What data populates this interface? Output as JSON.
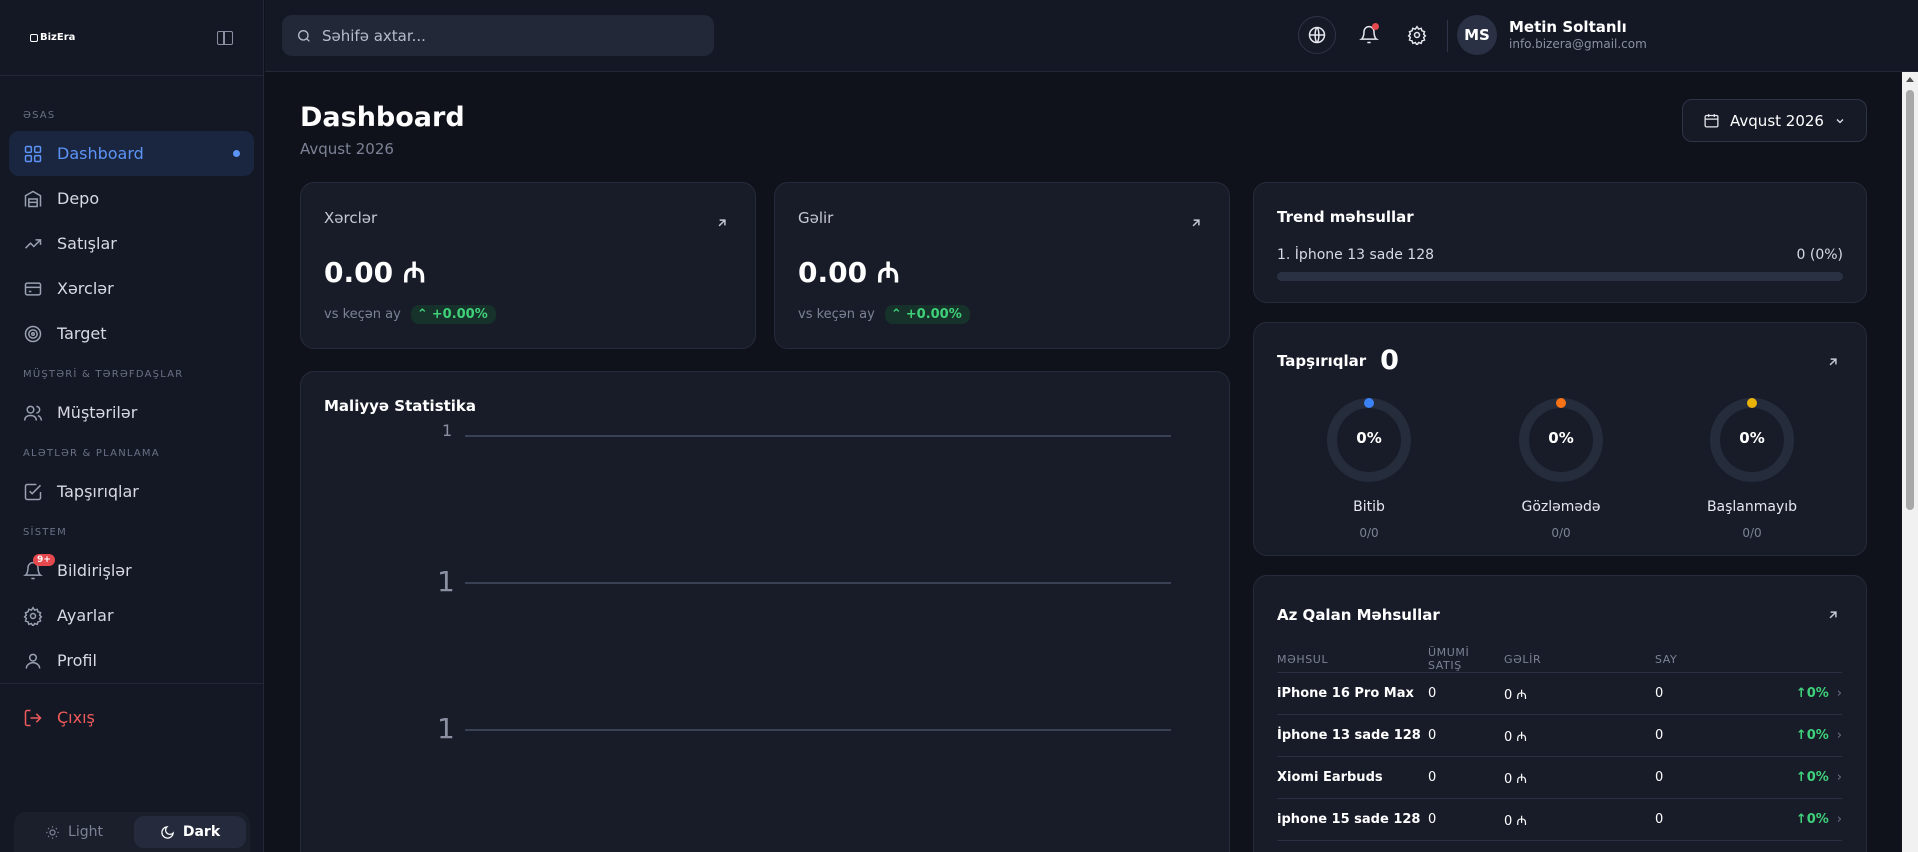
{
  "app": {
    "logo": "BizEra"
  },
  "sidebar": {
    "sections": [
      "ƏSAS",
      "MÜŞTƏRİ & TƏRƏFDAŞLAR",
      "ALƏTLƏR & PLANLAMA",
      "SİSTEM"
    ],
    "items": [
      {
        "label": "Dashboard",
        "icon": "grid-icon",
        "active": true
      },
      {
        "label": "Depo",
        "icon": "warehouse-icon"
      },
      {
        "label": "Satışlar",
        "icon": "trending-up-icon"
      },
      {
        "label": "Xərclər",
        "icon": "card-icon"
      },
      {
        "label": "Target",
        "icon": "target-icon"
      },
      {
        "label": "Müştərilər",
        "icon": "users-icon"
      },
      {
        "label": "Tapşırıqlar",
        "icon": "checkbox-icon"
      },
      {
        "label": "Bildirişlər",
        "icon": "bell-icon",
        "badge": "9+"
      },
      {
        "label": "Ayarlar",
        "icon": "gear-icon"
      },
      {
        "label": "Profil",
        "icon": "user-icon"
      }
    ],
    "logout": "Çıxış",
    "theme": {
      "light": "Light",
      "dark": "Dark",
      "selected": "Dark"
    }
  },
  "header": {
    "search_placeholder": "Səhifə axtar...",
    "user": {
      "initials": "MS",
      "name": "Metin Soltanlı",
      "email": "info.bizera@gmail.com"
    }
  },
  "page": {
    "title": "Dashboard",
    "subtitle": "Avqust 2026",
    "date_picker": "Avqust 2026"
  },
  "stats": [
    {
      "label": "Xərclər",
      "value": "0.00 ₼",
      "compare": "vs keçən ay",
      "change": "+0.00%"
    },
    {
      "label": "Gəlir",
      "value": "0.00 ₼",
      "compare": "vs keçən ay",
      "change": "+0.00%"
    }
  ],
  "finance_chart": {
    "title": "Maliyyə Statistika",
    "y_ticks": [
      "1",
      "1",
      "1"
    ]
  },
  "trend": {
    "title": "Trend məhsullar",
    "items": [
      {
        "name": "1. İphone 13 sade 128",
        "value": "0 (0%)",
        "fill": 0
      }
    ]
  },
  "tasks": {
    "title": "Tapşırıqlar",
    "count": "0",
    "rings": [
      {
        "pct": "0%",
        "label": "Bitib",
        "sub": "0/0",
        "color": "#3b82f6"
      },
      {
        "pct": "0%",
        "label": "Gözləmədə",
        "sub": "0/0",
        "color": "#f97316"
      },
      {
        "pct": "0%",
        "label": "Başlanmayıb",
        "sub": "0/0",
        "color": "#eab308"
      }
    ]
  },
  "low_stock": {
    "title": "Az Qalan Məhsullar",
    "headers": [
      "MƏHSUL",
      "ÜMUMİ SATIŞ",
      "GƏLİR",
      "SAY",
      ""
    ],
    "rows": [
      {
        "name": "iPhone 16 Pro Max",
        "sales": "0",
        "revenue": "0 ₼",
        "count": "0",
        "pct": "↑0%"
      },
      {
        "name": "İphone 13 sade 128",
        "sales": "0",
        "revenue": "0 ₼",
        "count": "0",
        "pct": "↑0%"
      },
      {
        "name": "Xiomi Earbuds",
        "sales": "0",
        "revenue": "0 ₼",
        "count": "0",
        "pct": "↑0%"
      },
      {
        "name": "iphone 15 sade 128",
        "sales": "0",
        "revenue": "0 ₼",
        "count": "0",
        "pct": "↑0%"
      }
    ]
  }
}
